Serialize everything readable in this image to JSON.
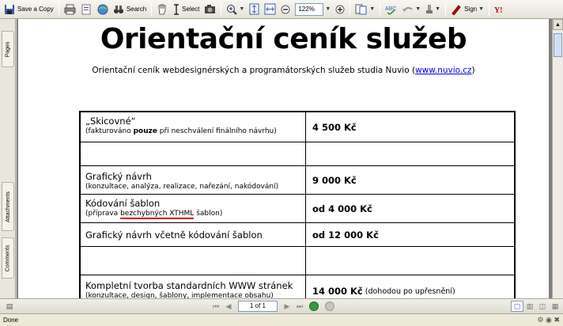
{
  "toolbar": {
    "save_copy_label": "Save a Copy",
    "search_label": "Search",
    "select_label": "Select",
    "zoom_value": "122%",
    "sign_label": "Sign"
  },
  "left_panel": {
    "tabs": [
      "Pages",
      "Attachments",
      "Comments"
    ]
  },
  "document": {
    "title": "Orientační ceník služeb",
    "subtitle_text": "Orientační ceník webdesignérských a programátorských služeb studia Nuvio (",
    "subtitle_link": "www.nuvio.cz",
    "subtitle_end": ")",
    "rows": [
      {
        "name": "„Skicovné“",
        "note_before": "(fakturováno ",
        "note_bold": "pouze",
        "note_after": " při neschválení finálního návrhu)",
        "price": "4 500 Kč"
      },
      {
        "empty": true
      },
      {
        "name": "Grafický návrh",
        "note": "(konzultace, analýza, realizace, nařezání, nakódování)",
        "price": "9 000 Kč"
      },
      {
        "name": "Kódování šablon",
        "note_before": "(příprava ",
        "note_marked": "bezchybných XTHML",
        "note_after": " šablon)",
        "price": "od 4 000 Kč"
      },
      {
        "name": "Grafický návrh včetně kódování šablon",
        "price": "od 12 000 Kč"
      },
      {
        "empty": true
      },
      {
        "name": "Kompletní tvorba standardních WWW stránek",
        "note": "(konzultace, design, šablony, implementace obsahu)",
        "price": "14 000 Kč",
        "price_note": "(dohodou po upřesnění)"
      }
    ]
  },
  "navigation": {
    "page_indicator": "1 of 1"
  },
  "status": {
    "text": "Done"
  },
  "colors": {
    "link": "#0000ee",
    "spellcheck_underline": "#e00000",
    "chrome": "#d4d0c8"
  }
}
